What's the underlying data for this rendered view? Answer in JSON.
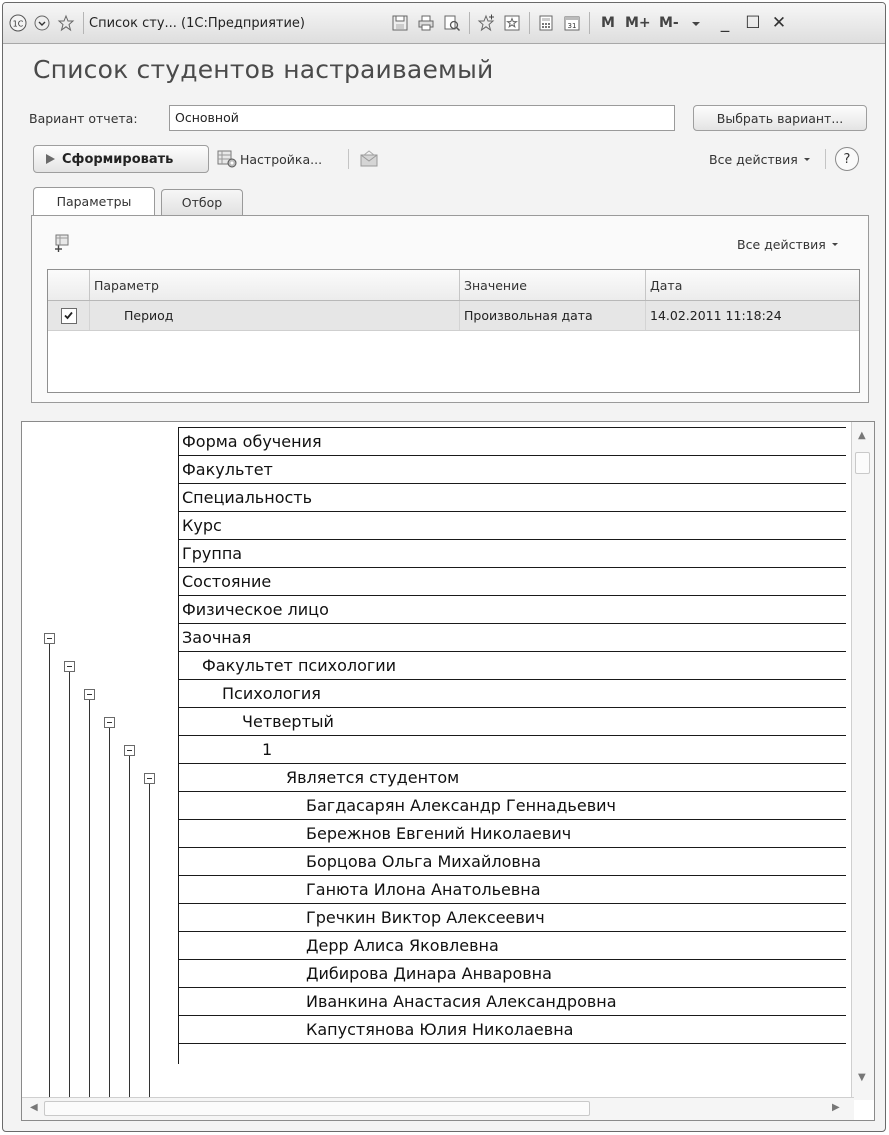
{
  "window": {
    "title": "Список сту... (1С:Предприятие)",
    "calc_buttons": [
      "M",
      "M+",
      "M-"
    ],
    "controls": [
      "_",
      "☐",
      "✕"
    ]
  },
  "form": {
    "heading": "Список студентов настраиваемый",
    "variant_label": "Вариант отчета:",
    "variant_value": "Основной",
    "choose_variant": "Выбрать вариант...",
    "generate": "Сформировать",
    "settings": "Настройка...",
    "all_actions": "Все действия",
    "help": "?"
  },
  "tabs": [
    {
      "label": "Параметры",
      "active": true
    },
    {
      "label": "Отбор",
      "active": false
    }
  ],
  "params": {
    "all_actions": "Все действия",
    "columns": [
      "Параметр",
      "Значение",
      "Дата"
    ],
    "rows": [
      {
        "checked": true,
        "name": "Период",
        "value": "Произвольная дата",
        "date": "14.02.2011 11:18:24"
      }
    ]
  },
  "report": {
    "rows": [
      "Форма обучения",
      "Факультет",
      "Специальность",
      "Курс",
      "Группа",
      "Состояние",
      "Физическое лицо",
      "Заочная",
      "Факультет психологии",
      "Психология",
      "Четвертый",
      "1",
      "Является студентом",
      "Багдасарян Александр Геннадьевич",
      "Бережнов Евгений  Николаевич",
      "Борцова Ольга Михайловна",
      "Ганюта Илона Анатольевна",
      "Гречкин Виктор Алексеевич",
      "Дерр Алиса Яковлевна",
      "Дибирова Динара Анваровна",
      "Иванкина Анастасия Александровна",
      "Капустянова Юлия Николаевна"
    ]
  }
}
